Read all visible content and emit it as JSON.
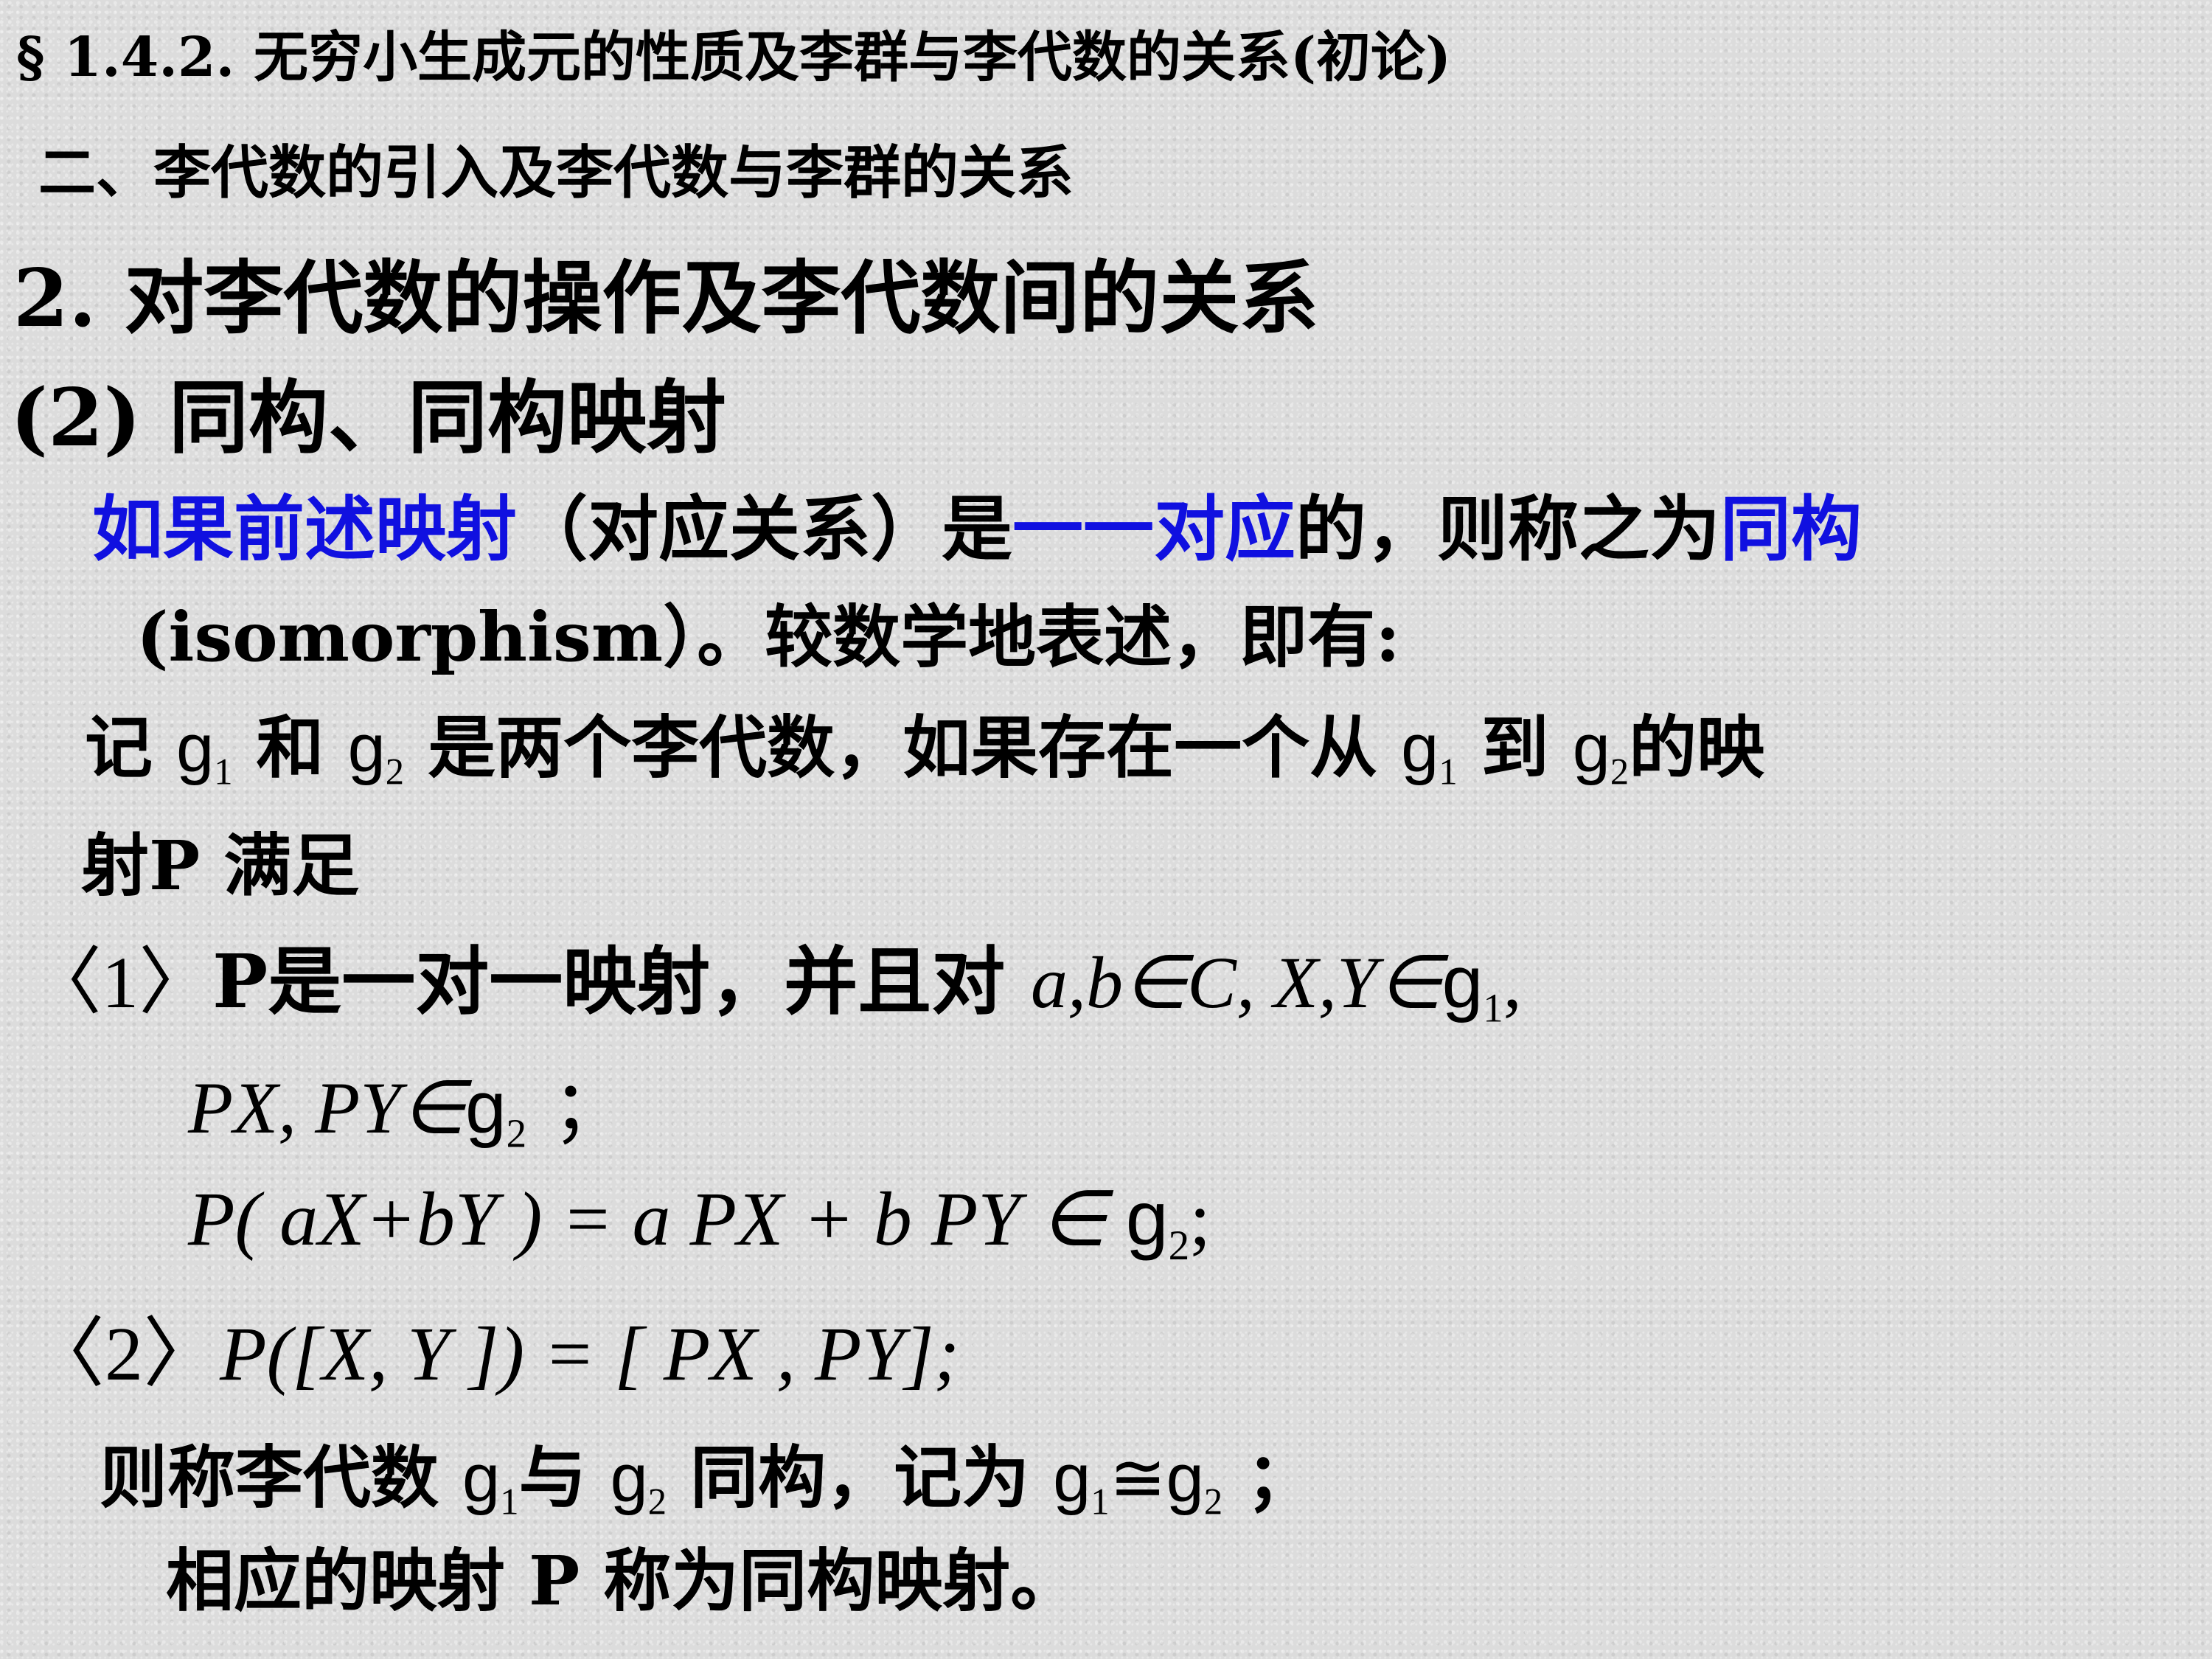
{
  "header": {
    "section": "§ 1.4.2. 无穷小生成元的性质及李群与李代数的关系(初论)",
    "subtitle": "二、李代数的引入及李代数与李群的关系"
  },
  "heading": "2. 对李代数的操作及李代数间的关系",
  "subheading": "(2) 同构、同构映射",
  "para1": {
    "blue1": "如果前述映射",
    "t1": "（对应关系）是",
    "blue2": "一一对应",
    "t2": "的，则称之为",
    "blue3": "同构"
  },
  "para2": {
    "t1": "(isomorphism）。较数学地表述，即有:"
  },
  "para3": {
    "t1": "记",
    "t2": "和",
    "t3": "是两个李代数，如果存在一个从",
    "t4": "到",
    "t5": "的映",
    "t6": "射P 满足"
  },
  "cond1": {
    "label": "〈1〉",
    "t1": "P是一对一映射，并且对",
    "math1": "a,b∈C,  X,Y∈",
    "line2": "PX, PY∈",
    "line2_end": "；",
    "line3a": "P( aX+bY ) = a PX + b PY ∈ ",
    "line3_end": ";"
  },
  "cond2": {
    "label": "〈2〉",
    "formula": "P([X, Y ]) = [ PX ,  PY];"
  },
  "conclusion": {
    "t1": "则称李代数",
    "t2": "与",
    "t3": "同构，记为",
    "t4": "≅",
    "t5": "；",
    "t6": "相应的映射 P 称为同构映射。"
  },
  "symbols": {
    "g": "g",
    "sub1": "1",
    "sub2": "2"
  },
  "colors": {
    "accent_blue": "#1010e0",
    "background": "#dcdcdc"
  }
}
